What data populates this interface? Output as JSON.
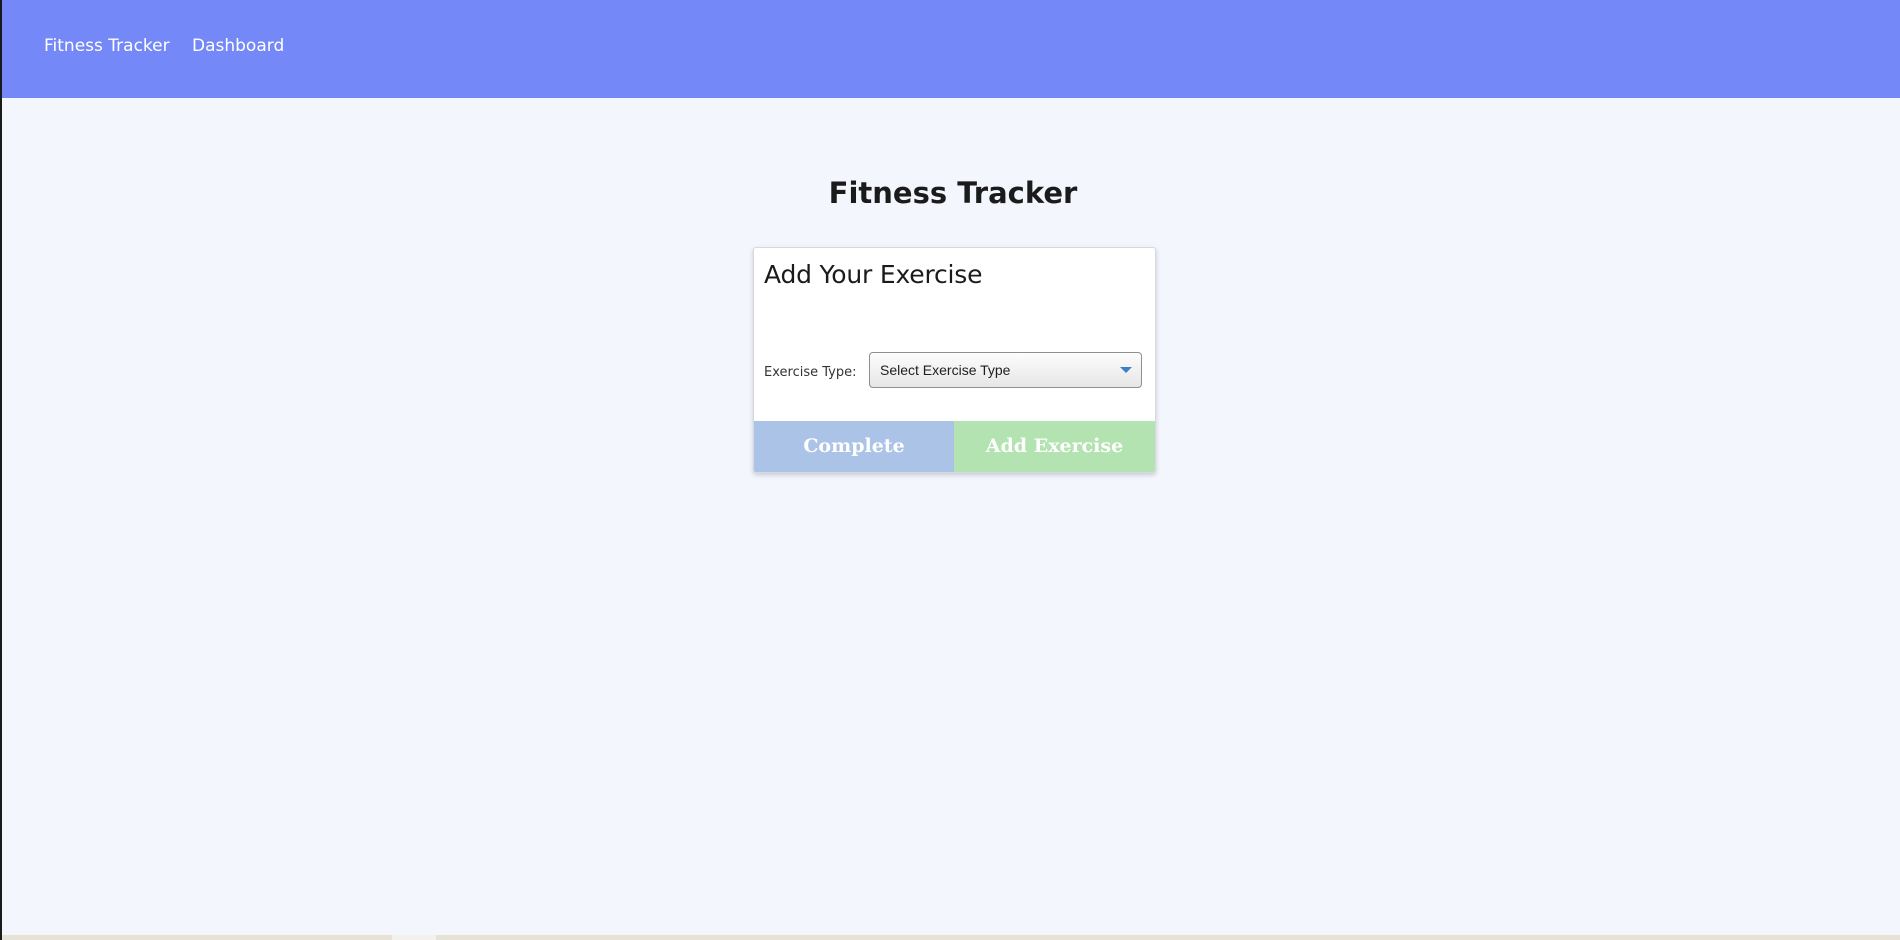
{
  "navbar": {
    "brand": "Fitness Tracker",
    "links": [
      {
        "label": "Dashboard"
      }
    ],
    "color": "#7489f7"
  },
  "main": {
    "title": "Fitness Tracker"
  },
  "exercise_form": {
    "title": "Add Your Exercise",
    "exercise_type_label": "Exercise Type:",
    "exercise_type_select": {
      "selected": "Select Exercise Type"
    },
    "complete_button": "Complete",
    "add_exercise_button": "Add Exercise",
    "complete_color": "#abc3e7",
    "add_color": "#b3e3b0"
  },
  "icons": {
    "select_arrow": "chevron-down-icon"
  }
}
